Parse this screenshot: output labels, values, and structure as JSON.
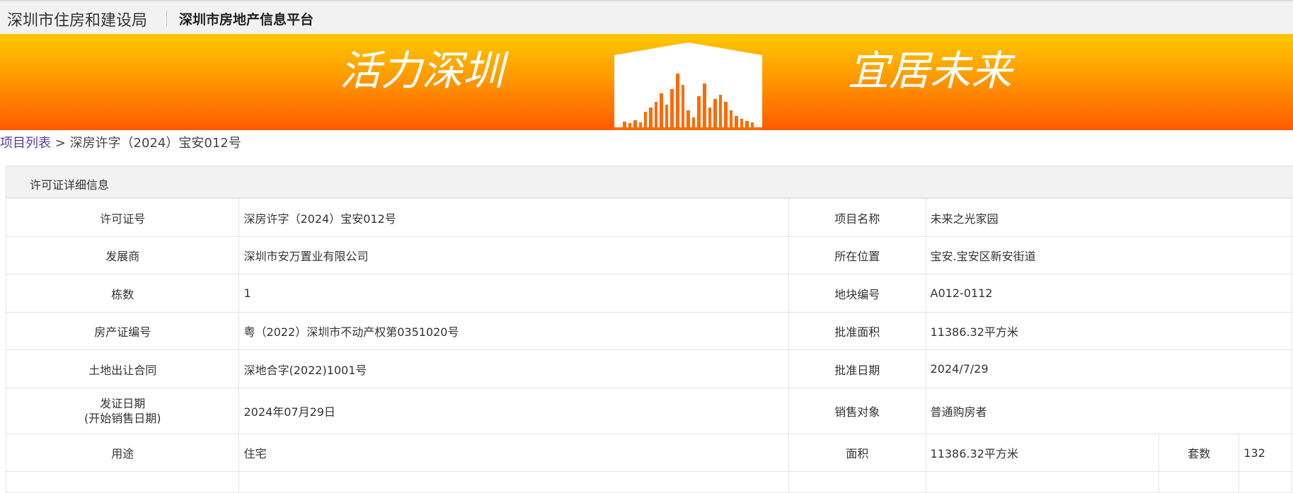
{
  "header": {
    "agency": "深圳市住房和建设局",
    "platform": "深圳市房地产信息平台"
  },
  "banner": {
    "slogan_left": "活力深圳",
    "slogan_right": "宜居未来"
  },
  "breadcrumb": {
    "link": "项目列表",
    "separator": ">",
    "current": "深房许字（2024）宝安012号"
  },
  "panel": {
    "title": "许可证详细信息"
  },
  "details": {
    "permit_no_label": "许可证号",
    "permit_no": "深房许字（2024）宝安012号",
    "project_name_label": "项目名称",
    "project_name": "未来之光家园",
    "developer_label": "发展商",
    "developer": "深圳市安万置业有限公司",
    "location_label": "所在位置",
    "location": "宝安.宝安区新安街道",
    "buildings_label": "栋数",
    "buildings": "1",
    "plot_no_label": "地块编号",
    "plot_no": "A012-0112",
    "property_cert_label": "房产证编号",
    "property_cert": "粤（2022）深圳市不动产权第0351020号",
    "approved_area_label": "批准面积",
    "approved_area": "11386.32平方米",
    "land_contract_label": "土地出让合同",
    "land_contract": "深地合字(2022)1001号",
    "approval_date_label": "批准日期",
    "approval_date": "2024/7/29",
    "issue_date_label_1": "发证日期",
    "issue_date_label_2": "(开始销售日期)",
    "issue_date": "2024年07月29日",
    "sales_target_label": "销售对象",
    "sales_target": "普通购房者",
    "usage_label": "用途",
    "usage": "住宅",
    "area_label": "面积",
    "area": "11386.32平方米",
    "units_label": "套数",
    "units": "132"
  },
  "colors": {
    "banner_top": "#ffc800",
    "banner_bottom": "#ff5a00",
    "link": "#5a3b9a",
    "border": "#e3e3e3"
  }
}
